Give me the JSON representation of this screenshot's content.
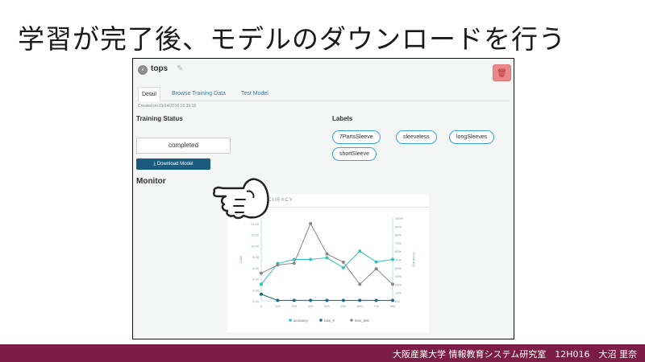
{
  "slide": {
    "title": "学習が完了後、モデルのダウンロードを行う",
    "footer": "大阪産業大学 情報教育システム研究室　12H016　大沼 里奈"
  },
  "app": {
    "model_name": "tops",
    "back_icon": "chevron-left-icon",
    "edit_icon": "pencil-icon",
    "delete_icon": "trash-icon",
    "tabs": [
      {
        "label": "Detail",
        "active": true
      },
      {
        "label": "Browse Training Data",
        "active": false
      },
      {
        "label": "Test Model",
        "active": false
      }
    ],
    "created": "Created on 01/14/2016 15:39:18",
    "training_status": {
      "heading": "Training Status",
      "value": "completed",
      "download_label": "Download Model",
      "download_icon": "download-icon"
    },
    "labels": {
      "heading": "Labels",
      "items": [
        "7PartsSleeve",
        "sleeveless",
        "longSleeves",
        "shortSleeve"
      ]
    },
    "monitor": {
      "heading": "Monitor"
    },
    "colors": {
      "accent": "#1b5c7e",
      "chip_border": "#3aa7c7",
      "delete": "#e8888a",
      "footer": "#7a1c45"
    }
  },
  "chart_data": {
    "type": "line",
    "title": "ACCURACY",
    "x": [
      0,
      100,
      200,
      300,
      400,
      500,
      600,
      700,
      800
    ],
    "x_ticks": [
      "0",
      "100",
      "200",
      "300",
      "400",
      "500",
      "600",
      "700",
      "800"
    ],
    "ylabel": "Loss",
    "ylim": [
      0,
      15
    ],
    "y_ticks": [
      "0.00",
      "2.00",
      "4.00",
      "6.00",
      "8.00",
      "10.00",
      "12.00",
      "14.00"
    ],
    "y2label": "Accuracy",
    "y2lim": [
      0,
      100
    ],
    "y2_ticks": [
      "0%",
      "10%",
      "20%",
      "30%",
      "40%",
      "50%",
      "60%",
      "70%",
      "80%",
      "90%",
      "100%"
    ],
    "series": [
      {
        "name": "accuracy",
        "axis": "right",
        "color": "#2ec4b6",
        "values": [
          20,
          45,
          50,
          50,
          52,
          40,
          60,
          47,
          50
        ]
      },
      {
        "name": "loss_0",
        "axis": "left",
        "color": "#1e6a7a",
        "values": [
          1.2,
          0.1,
          0.1,
          0.1,
          0.1,
          0.1,
          0.1,
          0.1,
          0.1
        ]
      },
      {
        "name": "loss_test",
        "axis": "left",
        "color": "#888888",
        "values": [
          5.0,
          6.5,
          6.8,
          14.0,
          8.5,
          7.0,
          3.0,
          5.8,
          3.0
        ]
      }
    ],
    "grid": false,
    "legend": "bottom"
  }
}
